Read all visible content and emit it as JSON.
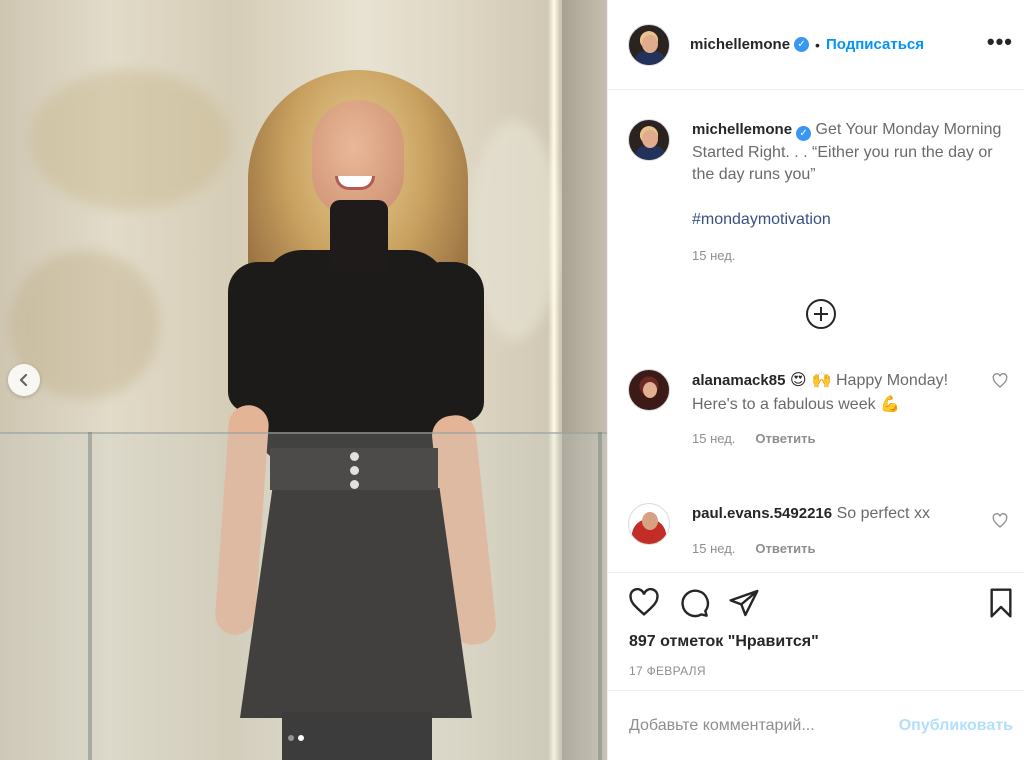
{
  "post": {
    "username": "michellemone",
    "verified": true,
    "follow_label": "Подписаться",
    "dot_separator": "•",
    "more_label": "•••"
  },
  "caption": {
    "username": "michellemone",
    "text": "Get Your Monday Morning Started Right. . . “Either you run the day or the day runs you”",
    "hashtag": "#mondaymotivation",
    "time": "15 нед."
  },
  "comments": [
    {
      "username": "alanamack85",
      "emoji_prefix": "😍 🙌",
      "text": "Happy Monday! Here's to a fabulous week",
      "emoji_suffix": "💪",
      "time": "15 нед.",
      "reply_label": "Ответить"
    },
    {
      "username": "paul.evans.5492216",
      "emoji_prefix": "",
      "text": "So perfect xx",
      "emoji_suffix": "",
      "time": "15 нед.",
      "reply_label": "Ответить"
    }
  ],
  "actions": {
    "likes": "897 отметок \"Нравится\"",
    "date": "17 ФЕВРАЛЯ"
  },
  "add_comment": {
    "placeholder": "Добавьте комментарий...",
    "publish_label": "Опубликовать"
  },
  "carousel": {
    "slide_count": 2,
    "active_slide": 2
  },
  "colors": {
    "link_blue": "#0095f6",
    "hashtag_blue": "#385185",
    "publish_disabled": "#b2dffc",
    "verified_badge": "#3897f0"
  }
}
